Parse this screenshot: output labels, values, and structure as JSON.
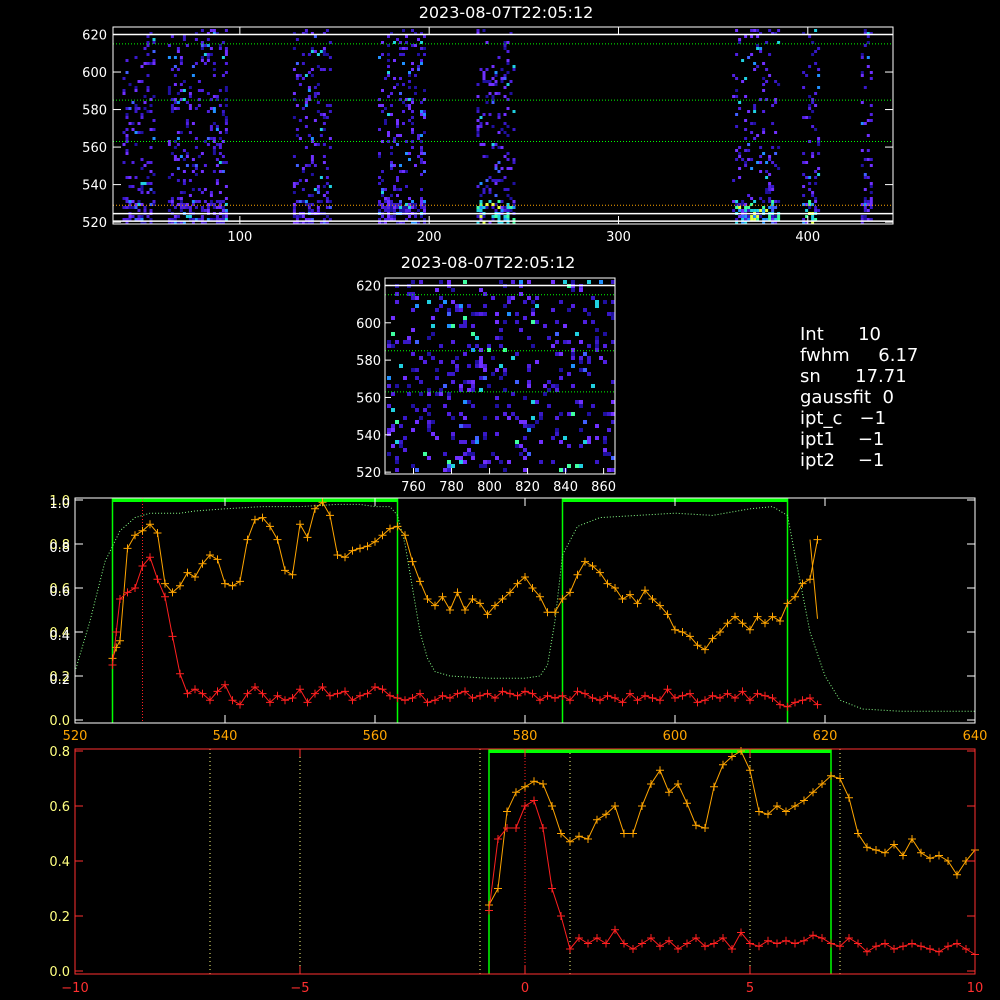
{
  "info": {
    "lines": [
      "Int      10",
      "fwhm     6.17",
      "sn      17.71",
      "gaussfit  0",
      "ipt_c   −1",
      "ipt1    −1",
      "ipt2    −1"
    ]
  },
  "colors": {
    "background": "#000000",
    "axis": "#ffffff",
    "orange": "#ffa500",
    "red": "#ff2020",
    "green": "#00ff00",
    "green_dot": "#88ff88",
    "yellow_dot": "#ffff80",
    "red_axis": "#ff3030"
  },
  "chart_data": [
    {
      "type": "heatmap",
      "name": "spectrogram-full",
      "title": "2023-08-07T22:05:12",
      "xlim": [
        33,
        445
      ],
      "ylim": [
        519,
        624
      ],
      "xticks": [
        100,
        200,
        300,
        400
      ],
      "yticks": [
        520,
        540,
        560,
        580,
        600,
        620
      ],
      "hlines_white": [
        520.5,
        524.5,
        620
      ],
      "hlines_green": [
        563,
        585,
        615
      ],
      "hlines_orange": [
        529
      ],
      "columns": [
        [
          38,
          55
        ],
        [
          62,
          93
        ],
        [
          128,
          148
        ],
        [
          173,
          197
        ],
        [
          225,
          245
        ],
        [
          360,
          385
        ],
        [
          397,
          405
        ],
        [
          428,
          433
        ]
      ],
      "hot_band_columns": [
        [
          225,
          245
        ],
        [
          360,
          385
        ],
        [
          397,
          405
        ]
      ]
    },
    {
      "type": "heatmap",
      "name": "spectrogram-zoom",
      "title": "2023-08-07T22:05:12",
      "xlim": [
        745,
        866
      ],
      "ylim": [
        519,
        624
      ],
      "xticks": [
        760,
        780,
        800,
        820,
        840,
        860
      ],
      "yticks": [
        520,
        540,
        560,
        580,
        600,
        620
      ],
      "hlines_white": [
        620
      ],
      "hlines_green": [
        563,
        585,
        615
      ]
    },
    {
      "type": "line",
      "name": "spectrum-profile",
      "xlim": [
        520,
        640
      ],
      "xticks": [
        520,
        540,
        560,
        580,
        600,
        620,
        640
      ],
      "yticks_left_a": [
        "0.0",
        "0.2",
        "0.4",
        "0.6",
        "0.8",
        "1.0"
      ],
      "yticks_left_b": [
        "0.2",
        "0.4",
        "0.6",
        "0.8",
        "1.0"
      ],
      "ylim": [
        0,
        1.0
      ],
      "green_boxes": [
        [
          525,
          563
        ],
        [
          585,
          615
        ]
      ],
      "vline_red": 529,
      "series": [
        {
          "style": "orange",
          "x": [
            525,
            525.5,
            526,
            527,
            528,
            529,
            530,
            531,
            532,
            533,
            534,
            535,
            536,
            537,
            538,
            539,
            540,
            541,
            542,
            543,
            544,
            545,
            546,
            547,
            548,
            549,
            550,
            551,
            552,
            553,
            554,
            555,
            556,
            557,
            558,
            559,
            560,
            561,
            562,
            563,
            564,
            565,
            566,
            567,
            568,
            569,
            570,
            571,
            572,
            573,
            574,
            575,
            576,
            577,
            578,
            579,
            580,
            581,
            582,
            583,
            584,
            585,
            586,
            587,
            588,
            589,
            590,
            591,
            592,
            593,
            594,
            595,
            596,
            597,
            598,
            599,
            600,
            601,
            602,
            603,
            604,
            605,
            606,
            607,
            608,
            609,
            610,
            611,
            612,
            613,
            614,
            615,
            616,
            617,
            618,
            619
          ],
          "y": [
            0.28,
            0.33,
            0.36,
            0.78,
            0.84,
            0.86,
            0.89,
            0.85,
            0.62,
            0.58,
            0.61,
            0.67,
            0.65,
            0.71,
            0.75,
            0.73,
            0.62,
            0.61,
            0.63,
            0.82,
            0.91,
            0.92,
            0.88,
            0.82,
            0.68,
            0.66,
            0.89,
            0.83,
            0.96,
            0.99,
            0.93,
            0.75,
            0.74,
            0.77,
            0.78,
            0.79,
            0.81,
            0.84,
            0.87,
            0.88,
            0.84,
            0.72,
            0.63,
            0.55,
            0.52,
            0.56,
            0.5,
            0.58,
            0.5,
            0.55,
            0.53,
            0.48,
            0.52,
            0.55,
            0.58,
            0.62,
            0.65,
            0.6,
            0.56,
            0.49,
            0.49,
            0.55,
            0.58,
            0.66,
            0.72,
            0.7,
            0.67,
            0.62,
            0.6,
            0.55,
            0.57,
            0.53,
            0.59,
            0.55,
            0.52,
            0.48,
            0.41,
            0.4,
            0.38,
            0.34,
            0.32,
            0.37,
            0.4,
            0.44,
            0.47,
            0.44,
            0.41,
            0.47,
            0.44,
            0.47,
            0.45,
            0.53,
            0.56,
            0.62,
            0.64,
            0.82
          ]
        },
        {
          "style": "red",
          "x": [
            525,
            525.5,
            526,
            527,
            528,
            529,
            530,
            531,
            532,
            533,
            534,
            535,
            536,
            537,
            538,
            539,
            540,
            541,
            542,
            543,
            544,
            545,
            546,
            547,
            548,
            549,
            550,
            551,
            552,
            553,
            554,
            555,
            556,
            557,
            558,
            559,
            560,
            561,
            562,
            563,
            564,
            565,
            566,
            567,
            568,
            569,
            570,
            571,
            572,
            573,
            574,
            575,
            576,
            577,
            578,
            579,
            580,
            581,
            582,
            583,
            584,
            585,
            586,
            587,
            588,
            589,
            590,
            591,
            592,
            593,
            594,
            595,
            596,
            597,
            598,
            599,
            600,
            601,
            602,
            603,
            604,
            605,
            606,
            607,
            608,
            609,
            610,
            611,
            612,
            613,
            614,
            615,
            616,
            617,
            618,
            619
          ],
          "y": [
            0.25,
            0.4,
            0.55,
            0.58,
            0.6,
            0.7,
            0.74,
            0.64,
            0.56,
            0.38,
            0.21,
            0.12,
            0.14,
            0.12,
            0.09,
            0.13,
            0.16,
            0.09,
            0.07,
            0.12,
            0.15,
            0.12,
            0.08,
            0.11,
            0.09,
            0.1,
            0.14,
            0.08,
            0.12,
            0.15,
            0.11,
            0.12,
            0.13,
            0.09,
            0.11,
            0.12,
            0.15,
            0.14,
            0.11,
            0.1,
            0.09,
            0.1,
            0.12,
            0.08,
            0.09,
            0.11,
            0.1,
            0.12,
            0.13,
            0.1,
            0.11,
            0.12,
            0.1,
            0.13,
            0.12,
            0.11,
            0.13,
            0.12,
            0.09,
            0.11,
            0.1,
            0.11,
            0.09,
            0.13,
            0.12,
            0.1,
            0.09,
            0.11,
            0.1,
            0.08,
            0.12,
            0.09,
            0.11,
            0.1,
            0.09,
            0.14,
            0.1,
            0.11,
            0.12,
            0.08,
            0.09,
            0.11,
            0.1,
            0.12,
            0.1,
            0.13,
            0.09,
            0.12,
            0.11,
            0.1,
            0.07,
            0.06,
            0.08,
            0.09,
            0.1,
            0.07
          ]
        },
        {
          "style": "green-dotted",
          "x": [
            520,
            522,
            524,
            526,
            528,
            530,
            532,
            534,
            536,
            540,
            545,
            550,
            555,
            558,
            560,
            562,
            563,
            564,
            565,
            566,
            567,
            568,
            570,
            575,
            580,
            582,
            583,
            584,
            585,
            587,
            590,
            595,
            600,
            605,
            610,
            613,
            615,
            616,
            618,
            620,
            622,
            625,
            630,
            635,
            640
          ],
          "y": [
            0.22,
            0.45,
            0.72,
            0.86,
            0.92,
            0.94,
            0.94,
            0.94,
            0.95,
            0.96,
            0.97,
            0.97,
            0.98,
            0.98,
            0.97,
            0.97,
            0.93,
            0.8,
            0.6,
            0.4,
            0.28,
            0.22,
            0.2,
            0.19,
            0.19,
            0.2,
            0.25,
            0.45,
            0.75,
            0.88,
            0.92,
            0.93,
            0.94,
            0.93,
            0.96,
            0.97,
            0.93,
            0.75,
            0.4,
            0.2,
            0.09,
            0.05,
            0.04,
            0.04,
            0.04
          ]
        }
      ]
    },
    {
      "type": "line",
      "name": "offset-profile",
      "xlim": [
        -10,
        10
      ],
      "xticks": [
        "−10",
        "−5",
        "0",
        "5",
        "10"
      ],
      "yticks": [
        "0.0",
        "0.2",
        "0.4",
        "0.6",
        "0.8"
      ],
      "ylim": [
        0,
        0.8
      ],
      "green_box": [
        -0.8,
        6.8
      ],
      "vlines_dotted": [
        -7,
        -5,
        -1,
        1,
        5,
        7
      ],
      "vline_red": 0,
      "series": [
        {
          "style": "orange",
          "x": [
            -0.8,
            -0.6,
            -0.4,
            -0.2,
            0.0,
            0.2,
            0.4,
            0.6,
            0.8,
            1.0,
            1.2,
            1.4,
            1.6,
            1.8,
            2.0,
            2.2,
            2.4,
            2.6,
            2.8,
            3.0,
            3.2,
            3.4,
            3.6,
            3.8,
            4.0,
            4.2,
            4.4,
            4.6,
            4.8,
            5.0,
            5.2,
            5.4,
            5.6,
            5.8,
            6.0,
            6.2,
            6.4,
            6.6,
            6.8,
            7.0,
            7.2,
            7.4,
            7.6,
            7.8,
            8.0,
            8.2,
            8.4,
            8.6,
            8.8,
            9.0,
            9.2,
            9.4,
            9.6,
            9.8,
            10.0
          ],
          "y": [
            0.24,
            0.3,
            0.58,
            0.65,
            0.67,
            0.69,
            0.68,
            0.6,
            0.5,
            0.47,
            0.49,
            0.48,
            0.55,
            0.57,
            0.6,
            0.5,
            0.5,
            0.6,
            0.68,
            0.73,
            0.65,
            0.68,
            0.61,
            0.53,
            0.52,
            0.67,
            0.75,
            0.78,
            0.8,
            0.73,
            0.58,
            0.57,
            0.6,
            0.58,
            0.6,
            0.62,
            0.65,
            0.68,
            0.71,
            0.7,
            0.63,
            0.5,
            0.45,
            0.44,
            0.43,
            0.46,
            0.42,
            0.48,
            0.43,
            0.41,
            0.42,
            0.4,
            0.35,
            0.4,
            0.44
          ]
        },
        {
          "style": "red",
          "x": [
            -0.8,
            -0.6,
            -0.4,
            -0.2,
            0.0,
            0.2,
            0.4,
            0.6,
            0.8,
            1.0,
            1.2,
            1.4,
            1.6,
            1.8,
            2.0,
            2.2,
            2.4,
            2.6,
            2.8,
            3.0,
            3.2,
            3.4,
            3.6,
            3.8,
            4.0,
            4.2,
            4.4,
            4.6,
            4.8,
            5.0,
            5.2,
            5.4,
            5.6,
            5.8,
            6.0,
            6.2,
            6.4,
            6.6,
            6.8,
            7.0,
            7.2,
            7.4,
            7.6,
            7.8,
            8.0,
            8.2,
            8.4,
            8.6,
            8.8,
            9.0,
            9.2,
            9.4,
            9.6,
            9.8,
            10.0
          ],
          "y": [
            0.22,
            0.48,
            0.52,
            0.52,
            0.6,
            0.62,
            0.52,
            0.3,
            0.2,
            0.08,
            0.12,
            0.1,
            0.12,
            0.1,
            0.15,
            0.1,
            0.08,
            0.1,
            0.12,
            0.09,
            0.11,
            0.08,
            0.1,
            0.12,
            0.09,
            0.1,
            0.12,
            0.08,
            0.14,
            0.1,
            0.09,
            0.11,
            0.1,
            0.11,
            0.1,
            0.11,
            0.13,
            0.12,
            0.1,
            0.09,
            0.12,
            0.1,
            0.07,
            0.09,
            0.1,
            0.08,
            0.09,
            0.1,
            0.09,
            0.08,
            0.07,
            0.09,
            0.1,
            0.08,
            0.06
          ]
        }
      ]
    }
  ]
}
